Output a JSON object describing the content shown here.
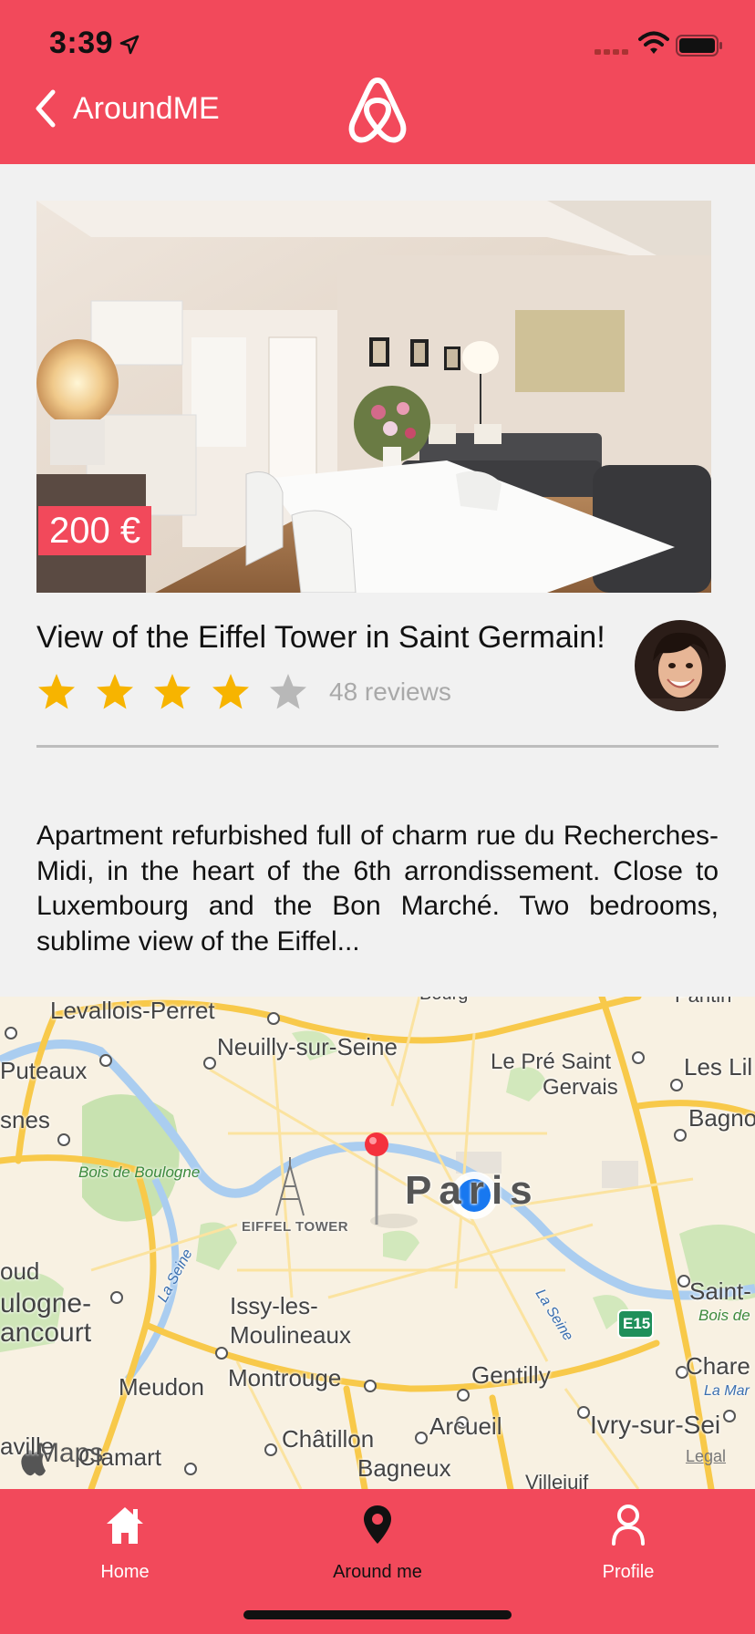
{
  "status_bar": {
    "time": "3:39"
  },
  "nav": {
    "back_label": "AroundME",
    "logo_icon": "airbnb-logo"
  },
  "listing": {
    "price": "200 €",
    "title": "View of the Eiffel Tower in Saint Germain!",
    "rating": 4,
    "rating_max": 5,
    "reviews": "48 reviews",
    "description": "Apartment refurbished full of charm rue du Recherches-Midi, in the heart of the 6th arrondissement. Close to Luxembourg and the Bon Marché. Two bedrooms, sublime view of the Eiffel..."
  },
  "map": {
    "labels": {
      "levallois": "Levallois-Perret",
      "neuilly": "Neuilly-sur-Seine",
      "pre_saint": "Le Pré Saint",
      "gervais": "Gervais",
      "lilas": "Les Lil",
      "puteaux": "Puteaux",
      "snes": "snes",
      "bagnolet": "Bagno",
      "bois_boulogne": "Bois de Boulogne",
      "paris": "Paris",
      "eiffel": "EIFFEL TOWER",
      "oud": "oud",
      "boulogne1": "ulogne-",
      "boulogne2": "ancourt",
      "issy1": "Issy-les-",
      "issy2": "Moulineaux",
      "seine1": "La Seine",
      "seine2": "La Seine",
      "saint": "Saint-",
      "bois_vin": "Bois de",
      "e15": "E15",
      "charenton": "Chare",
      "la_marne": "La Mar",
      "meudon": "Meudon",
      "montrouge": "Montrouge",
      "gentilly": "Gentilly",
      "arcueil": "Arcueil",
      "ivry": "Ivry-sur-Sei",
      "chatillon": "Châtillon",
      "clamart": "Clamart",
      "bagneux": "Bagneux",
      "ville": "aville",
      "villejuif": "Villejuif",
      "bourg": "Bourg",
      "pantin": "Pantin",
      "maps": "Maps",
      "legal": "Legal"
    }
  },
  "tabs": [
    {
      "label": "Home",
      "icon": "home-icon",
      "active": false
    },
    {
      "label": "Around me",
      "icon": "location-pin-icon",
      "active": true
    },
    {
      "label": "Profile",
      "icon": "profile-icon",
      "active": false
    }
  ],
  "colors": {
    "brand": "#f2495b",
    "star": "#f7b400",
    "star_empty": "#b8b8b8"
  }
}
